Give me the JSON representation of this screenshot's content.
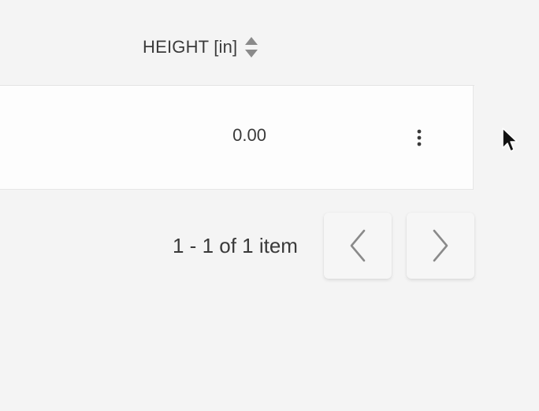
{
  "table": {
    "columns": [
      {
        "label": "HEIGHT [in]",
        "sortable": true
      }
    ],
    "rows": [
      {
        "height": "0.00"
      }
    ],
    "row_menu_icon": "more-vertical-icon"
  },
  "pagination": {
    "summary": "1 - 1 of 1 item",
    "prev_icon": "chevron-left-icon",
    "next_icon": "chevron-right-icon"
  },
  "colors": {
    "background": "#f4f4f4",
    "row_background": "#fdfdfd",
    "text": "#3a3a3a",
    "icon_gray": "#8a8a8a"
  }
}
